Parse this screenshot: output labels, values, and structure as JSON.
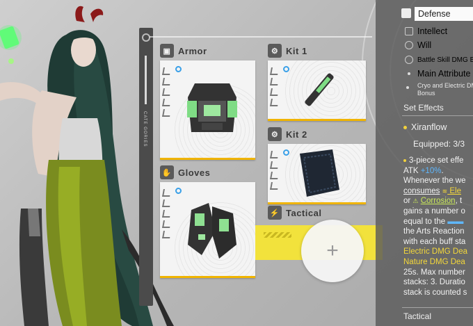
{
  "slots": {
    "armor": {
      "label": "Armor"
    },
    "gloves": {
      "label": "Gloves"
    },
    "kit1": {
      "label": "Kit 1"
    },
    "kit2": {
      "label": "Kit 2"
    },
    "tactical": {
      "label": "Tactical"
    }
  },
  "rail": {
    "vertical_text": "CATE GORIES"
  },
  "panel": {
    "attributes": [
      "Defense",
      "Intellect",
      "Will"
    ],
    "battle_skill": "Battle Skill DMG B",
    "main_attribute": "Main Attribute",
    "bonus_line1": "Cryo and Electric DMG",
    "bonus_line2": "Bonus",
    "set_effects_title": "Set Effects",
    "set_name": "Xiranflow",
    "equipped": "Equipped: 3/3",
    "desc": {
      "l1": "3-piece set effe",
      "l2_a": "ATK ",
      "l2_b": "+10%",
      "l2_c": ".",
      "l3": "Whenever the we",
      "l4_a": "consumes",
      "l4_b": " Ele",
      "l5_a": "or ",
      "l5_b": "Corrosion",
      "l5_c": ", t",
      "l6": "gains a number o",
      "l7": "equal to the",
      "l8": "the Arts Reaction",
      "l9": "with each buff sta",
      "l10": "Electric DMG Dea",
      "l11": "Nature DMG Dea",
      "l12": "25s. Max number",
      "l13": "stacks: 3. Duratio",
      "l14": "stack is counted s"
    },
    "tactical_title": "Tactical"
  },
  "colors": {
    "accent_yellow": "#f2e23c",
    "card_border": "#f0b400",
    "highlight_blue": "#5fb8ff",
    "green_glow": "#4cff6a"
  }
}
